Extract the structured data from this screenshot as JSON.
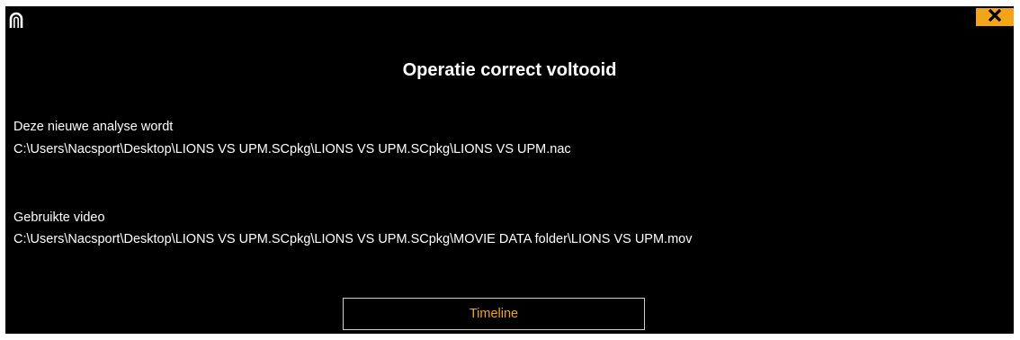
{
  "dialog": {
    "title": "Operatie correct voltooid",
    "analysis_label": "Deze nieuwe analyse wordt",
    "analysis_path": "C:\\Users\\Nacsport\\Desktop\\LIONS VS UPM.SCpkg\\LIONS VS UPM.SCpkg\\LIONS VS UPM.nac",
    "video_label": "Gebruikte video",
    "video_path": "C:\\Users\\Nacsport\\Desktop\\LIONS VS UPM.SCpkg\\LIONS VS UPM.SCpkg\\MOVIE DATA folder\\LIONS VS UPM.mov",
    "timeline_button": "Timeline"
  },
  "icons": {
    "logo": "nacsport-logo-icon",
    "close": "close-icon"
  },
  "colors": {
    "background": "#000000",
    "accent": "#f4a417",
    "text": "#ffffff",
    "button_border": "#cfcfcf"
  }
}
